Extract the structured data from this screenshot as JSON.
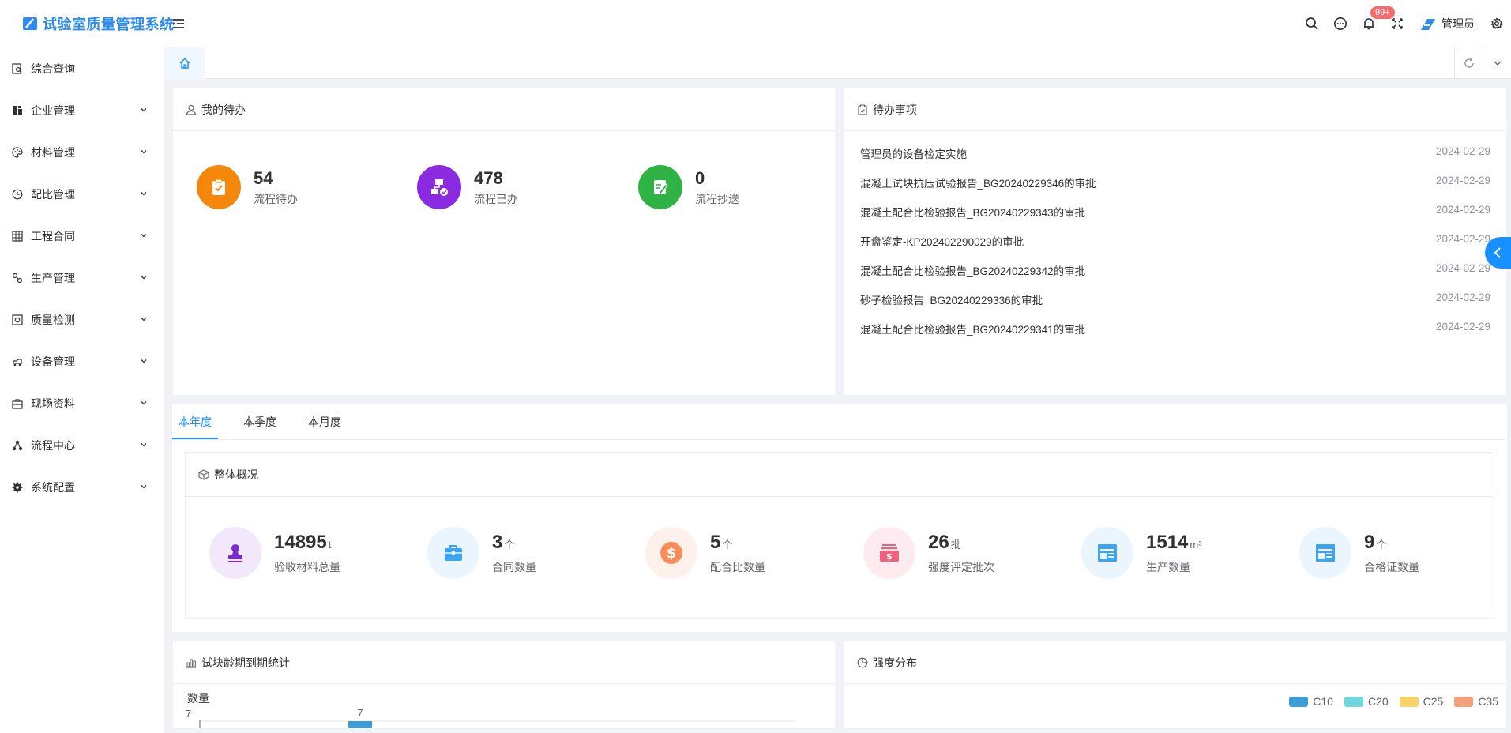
{
  "app": {
    "title": "试验室质量管理系统"
  },
  "header": {
    "notification_badge": "99+",
    "user_name": "管理员"
  },
  "sidebar": {
    "items": [
      {
        "label": "综合查询",
        "icon": "search-doc-icon",
        "expandable": false
      },
      {
        "label": "企业管理",
        "icon": "enterprise-icon",
        "expandable": true
      },
      {
        "label": "材料管理",
        "icon": "palette-icon",
        "expandable": true
      },
      {
        "label": "配比管理",
        "icon": "clock-icon",
        "expandable": true
      },
      {
        "label": "工程合同",
        "icon": "grid-icon",
        "expandable": true
      },
      {
        "label": "生产管理",
        "icon": "production-icon",
        "expandable": true
      },
      {
        "label": "质量检测",
        "icon": "quality-icon",
        "expandable": true
      },
      {
        "label": "设备管理",
        "icon": "equipment-icon",
        "expandable": true
      },
      {
        "label": "现场资料",
        "icon": "briefcase-icon",
        "expandable": true
      },
      {
        "label": "流程中心",
        "icon": "flow-icon",
        "expandable": true
      },
      {
        "label": "系统配置",
        "icon": "gear-icon",
        "expandable": true
      }
    ]
  },
  "my_todo": {
    "title": "我的待办",
    "stats": [
      {
        "value": "54",
        "label": "流程待办",
        "color": "#f5870a"
      },
      {
        "value": "478",
        "label": "流程已办",
        "color": "#8a2be2"
      },
      {
        "value": "0",
        "label": "流程抄送",
        "color": "#2fb344"
      }
    ]
  },
  "pending": {
    "title": "待办事项",
    "items": [
      {
        "title": "管理员的设备检定实施",
        "date": "2024-02-29"
      },
      {
        "title": "混凝土试块抗压试验报告_BG20240229346的审批",
        "date": "2024-02-29"
      },
      {
        "title": "混凝土配合比检验报告_BG20240229343的审批",
        "date": "2024-02-29"
      },
      {
        "title": "开盘鉴定-KP202402290029的审批",
        "date": "2024-02-29"
      },
      {
        "title": "混凝土配合比检验报告_BG20240229342的审批",
        "date": "2024-02-29"
      },
      {
        "title": "砂子检验报告_BG20240229336的审批",
        "date": "2024-02-29"
      },
      {
        "title": "混凝土配合比检验报告_BG20240229341的审批",
        "date": "2024-02-29"
      }
    ]
  },
  "period_tabs": {
    "active": 0,
    "items": [
      "本年度",
      "本季度",
      "本月度"
    ]
  },
  "overview": {
    "title": "整体概况",
    "items": [
      {
        "value": "14895",
        "unit": "t",
        "label": "验收材料总量",
        "color": "#7b2bd1",
        "bg": "#f1e8fb",
        "icon": "stamp-icon"
      },
      {
        "value": "3",
        "unit": "个",
        "label": "合同数量",
        "color": "#3aa5f3",
        "bg": "#eaf5fe",
        "icon": "toolbox-icon"
      },
      {
        "value": "5",
        "unit": "个",
        "label": "配合比数量",
        "color": "#fb8c5a",
        "bg": "#fef0ea",
        "icon": "dollar-icon"
      },
      {
        "value": "26",
        "unit": "批",
        "label": "强度评定批次",
        "color": "#f0607e",
        "bg": "#fdebef",
        "icon": "money-stack-icon"
      },
      {
        "value": "1514",
        "unit": "m³",
        "label": "生产数量",
        "color": "#3aa5f3",
        "bg": "#eaf5fe",
        "icon": "window-icon"
      },
      {
        "value": "9",
        "unit": "个",
        "label": "合格证数量",
        "color": "#3aa5f3",
        "bg": "#eaf5fe",
        "icon": "window-icon"
      }
    ]
  },
  "age_chart": {
    "title": "试块龄期到期统计",
    "chart_data": {
      "type": "bar",
      "ylabel": "数量",
      "ytick_visible": "7",
      "values": [
        7
      ],
      "value_labels": [
        "7"
      ],
      "color": "#3c9ddb"
    }
  },
  "strength": {
    "title": "强度分布",
    "legend": [
      {
        "name": "C10",
        "color": "#3c9ddb"
      },
      {
        "name": "C20",
        "color": "#6fd6dc"
      },
      {
        "name": "C25",
        "color": "#f8d36a"
      },
      {
        "name": "C35",
        "color": "#f4a07a"
      }
    ]
  }
}
